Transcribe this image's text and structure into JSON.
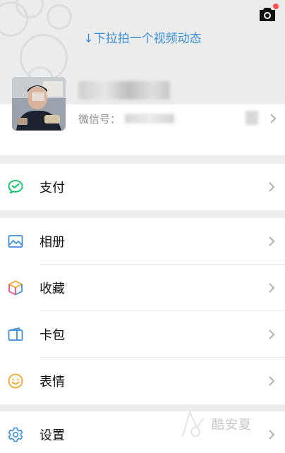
{
  "header": {
    "pull_hint": "↓下拉拍一个视频动态",
    "camera_icon": "camera-icon",
    "has_notification_dot": true
  },
  "profile": {
    "wechat_id_label": "微信号："
  },
  "menu": {
    "pay": {
      "label": "支付",
      "icon": "wechat-pay-icon"
    },
    "album": {
      "label": "相册",
      "icon": "album-icon"
    },
    "favorites": {
      "label": "收藏",
      "icon": "favorites-cube-icon"
    },
    "cards": {
      "label": "卡包",
      "icon": "card-wallet-icon"
    },
    "stickers": {
      "label": "表情",
      "icon": "smiley-icon"
    },
    "settings": {
      "label": "设置",
      "icon": "gear-icon"
    }
  },
  "watermark": {
    "text": "酷安夏"
  },
  "colors": {
    "accent_blue": "#3c8fd9",
    "pay_green": "#07c160",
    "smiley_orange": "#f5a623",
    "notify_red": "#fa5151"
  }
}
